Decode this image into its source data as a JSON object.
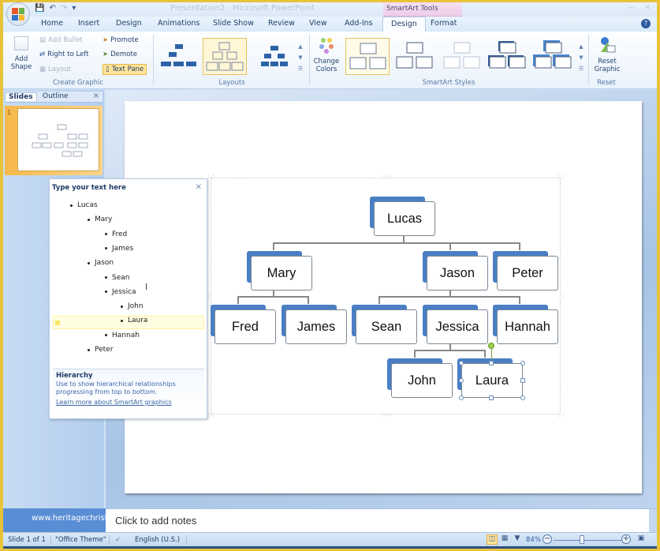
{
  "window": {
    "title": "Presentation2 - Microsoft PowerPoint",
    "contextual_tab_group": "SmartArt Tools",
    "quick_access": [
      "save-icon",
      "undo-icon",
      "redo-icon",
      "customize-icon"
    ]
  },
  "tabs": [
    {
      "label": "Home",
      "active": false
    },
    {
      "label": "Insert",
      "active": false
    },
    {
      "label": "Design",
      "active": false
    },
    {
      "label": "Animations",
      "active": false
    },
    {
      "label": "Slide Show",
      "active": false
    },
    {
      "label": "Review",
      "active": false
    },
    {
      "label": "View",
      "active": false
    },
    {
      "label": "Add-Ins",
      "active": false
    },
    {
      "label": "Design",
      "active": true
    },
    {
      "label": "Format",
      "active": false
    }
  ],
  "ribbon": {
    "create_graphic": {
      "label": "Create Graphic",
      "add_shape": "Add Shape",
      "add_bullet": "Add Bullet",
      "right_to_left": "Right to Left",
      "layout": "Layout",
      "promote": "Promote",
      "demote": "Demote",
      "text_pane": "Text Pane"
    },
    "layouts": {
      "label": "Layouts",
      "selected_index": 1
    },
    "smartart_styles": {
      "label": "SmartArt Styles",
      "change_colors": "Change Colors",
      "selected_index": 0
    },
    "reset": {
      "label": "Reset",
      "reset_graphic": "Reset Graphic"
    }
  },
  "slides_pane": {
    "tabs": [
      "Slides",
      "Outline"
    ],
    "active_tab": "Slides",
    "slide_number": "1"
  },
  "text_pane": {
    "title": "Type your text here",
    "items": [
      {
        "text": "Lucas",
        "level": 1
      },
      {
        "text": "Mary",
        "level": 2
      },
      {
        "text": "Fred",
        "level": 3
      },
      {
        "text": "James",
        "level": 3
      },
      {
        "text": "Jason",
        "level": 2
      },
      {
        "text": "Sean",
        "level": 3
      },
      {
        "text": "Jessica",
        "level": 3
      },
      {
        "text": "John",
        "level": 4
      },
      {
        "text": "Laura",
        "level": 4
      },
      {
        "text": "Hannah",
        "level": 3
      },
      {
        "text": "Peter",
        "level": 2
      }
    ],
    "selected_item": "Laura",
    "info_title": "Hierarchy",
    "info_description": "Use to show hierarchical relationships progressing from top to bottom.",
    "info_link": "Learn more about SmartArt graphics"
  },
  "org_chart": {
    "nodes": {
      "lucas": "Lucas",
      "mary": "Mary",
      "jason": "Jason",
      "peter": "Peter",
      "fred": "Fred",
      "james": "James",
      "sean": "Sean",
      "jessica": "Jessica",
      "hannah": "Hannah",
      "john": "John",
      "laura": "Laura"
    },
    "selected_node": "Laura",
    "accent_color": "#4a7fc4"
  },
  "notes": {
    "placeholder": "Click to add notes"
  },
  "watermark": "www.heritagechrist",
  "status_bar": {
    "slide_info": "Slide 1 of 1",
    "theme": "\"Office Theme\"",
    "language": "English (U.S.)",
    "zoom": "84%"
  }
}
